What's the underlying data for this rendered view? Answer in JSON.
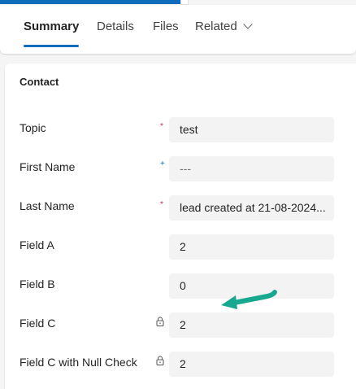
{
  "tabs": [
    {
      "label": "Summary",
      "active": true
    },
    {
      "label": "Details"
    },
    {
      "label": "Files"
    },
    {
      "label": "Related"
    }
  ],
  "section": {
    "title": "Contact"
  },
  "fields": [
    {
      "label": "Topic",
      "value": "test",
      "indicator": "required"
    },
    {
      "label": "First Name",
      "value": "---",
      "indicator": "recommended"
    },
    {
      "label": "Last Name",
      "value": "lead created at 21-08-2024...",
      "indicator": "required"
    },
    {
      "label": "Field A",
      "value": "2"
    },
    {
      "label": "Field B",
      "value": "0"
    },
    {
      "label": "Field C",
      "value": "2",
      "indicator": "locked"
    },
    {
      "label": "Field C with Null Check",
      "value": "2",
      "indicator": "locked"
    }
  ],
  "indicators": {
    "required": "*",
    "recommended": "+"
  },
  "colors": {
    "accent": "#0f6cbd",
    "required": "#c4314b",
    "arrow": "#18a88f"
  }
}
